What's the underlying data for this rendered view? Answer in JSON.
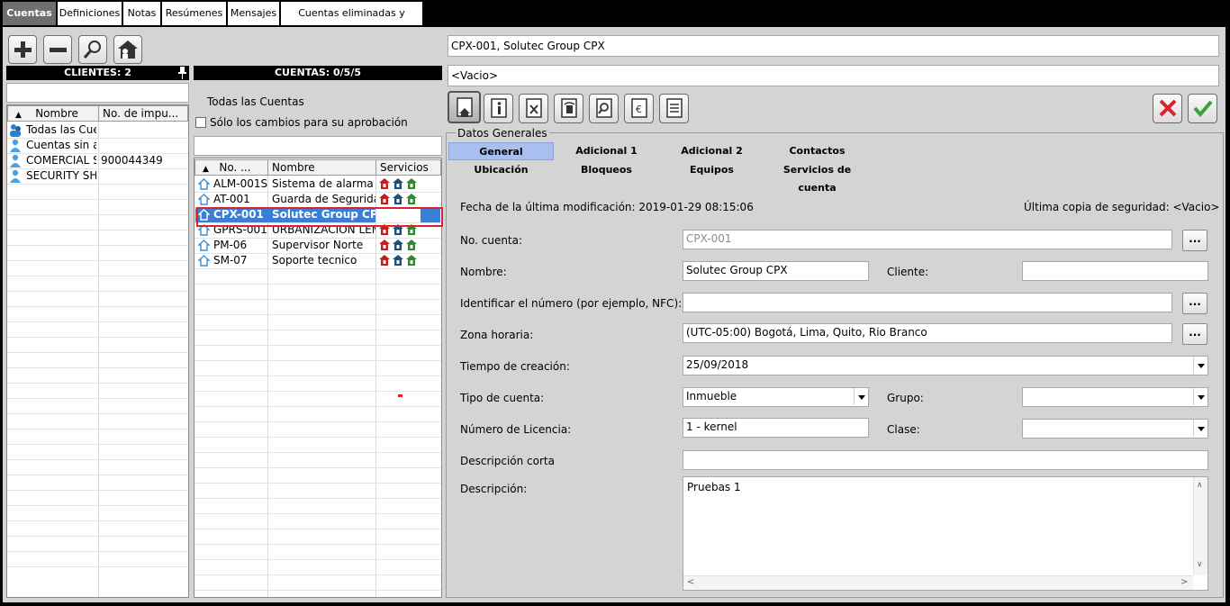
{
  "tabs": [
    "Cuentas",
    "Definiciones",
    "Notas",
    "Resúmenes",
    "Mensajes",
    "Cuentas eliminadas y remotas"
  ],
  "clients": {
    "header": "CLIENTES: 2",
    "search_value": "",
    "columns": [
      "Nombre",
      "No. de impu..."
    ],
    "rows": [
      {
        "name": "Todas las Cue",
        "tax": "",
        "icon": "group-icon"
      },
      {
        "name": "Cuentas sin a",
        "tax": "",
        "icon": "user-icon"
      },
      {
        "name": "COMERCIAL S",
        "tax": "900044349",
        "icon": "user-icon"
      },
      {
        "name": "SECURITY SH",
        "tax": "",
        "icon": "user-icon"
      }
    ]
  },
  "accounts": {
    "header": "CUENTAS: 0/5/5",
    "all_accounts": "Todas las Cuentas",
    "only_changes": "Sólo los cambios para su aprobación",
    "search_value": "",
    "columns": [
      "No. ...",
      "Nombre",
      "Servicios"
    ],
    "rows": [
      {
        "no": "ALM-001S",
        "name": "Sistema de alarma"
      },
      {
        "no": "AT-001",
        "name": "Guarda de Seguridad"
      },
      {
        "no": "CPX-001",
        "name": "Solutec Group CPX",
        "selected": true
      },
      {
        "no": "GPRS-001",
        "name": "URBANIZACION LEMO"
      },
      {
        "no": "PM-06",
        "name": "Supervisor Norte"
      },
      {
        "no": "SM-07",
        "name": "Soporte tecnico"
      }
    ]
  },
  "detail": {
    "title": "CPX-001, Solutec Group CPX",
    "subtitle": "<Vacio>",
    "group_label": "Datos Generales",
    "form_tabs_row1": [
      "General",
      "Adicional 1",
      "Adicional 2",
      "Contactos"
    ],
    "form_tabs_row2": [
      "Ubicación",
      "Bloqueos",
      "Equipos",
      "Servicios de cuenta"
    ],
    "last_modified": "Fecha de la última modificación: 2019-01-29 08:15:06",
    "last_backup": "Última copia de seguridad: <Vacio>",
    "labels": {
      "account_no": "No. cuenta:",
      "name": "Nombre:",
      "client": "Cliente:",
      "identify": "Identificar el número (por ejemplo, NFC):",
      "timezone": "Zona horaria:",
      "created": "Tiempo de creación:",
      "account_type": "Tipo de cuenta:",
      "group": "Grupo:",
      "license": "Número de Licencia:",
      "class": "Clase:",
      "short_desc": "Descripción corta",
      "description": "Descripción:"
    },
    "values": {
      "account_no": "CPX-001",
      "name": "Solutec Group CPX",
      "client": "",
      "identify": "",
      "timezone": "(UTC-05:00) Bogotá, Lima, Quito, Rio Branco",
      "created": "25/09/2018",
      "account_type": "Inmueble",
      "group": "",
      "license": "1 - kernel",
      "class": "",
      "short_desc": "",
      "description": "Pruebas 1"
    },
    "ellipsis": "..."
  },
  "colors": {
    "selected_row": "#3a7fd5",
    "highlight_box": "#d9232e",
    "active_tab": "#a8bff0"
  }
}
